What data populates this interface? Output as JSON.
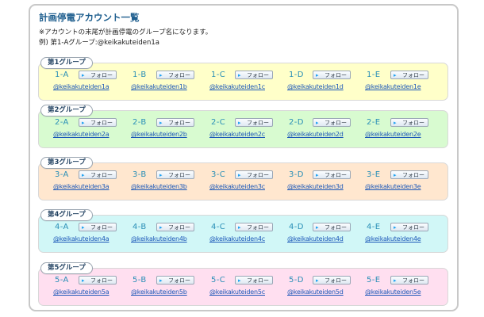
{
  "title": "計画停電アカウント一覧",
  "note1": "※アカウントの末尾が計画停電のグループ名になります。",
  "note2": "例) 第1-Aグループ:@keikakuteiden1a",
  "follow_label": "フォロー",
  "groups": [
    {
      "label": "第1グループ",
      "color": "#ffffc9",
      "accounts": [
        {
          "code": "1-A",
          "handle": "@keikakuteiden1a"
        },
        {
          "code": "1-B",
          "handle": "@keikakuteiden1b"
        },
        {
          "code": "1-C",
          "handle": "@keikakuteiden1c"
        },
        {
          "code": "1-D",
          "handle": "@keikakuteiden1d"
        },
        {
          "code": "1-E",
          "handle": "@keikakuteiden1e"
        }
      ]
    },
    {
      "label": "第2グループ",
      "color": "#d8fbd0",
      "accounts": [
        {
          "code": "2-A",
          "handle": "@keikakuteiden2a"
        },
        {
          "code": "2-B",
          "handle": "@keikakuteiden2b"
        },
        {
          "code": "2-C",
          "handle": "@keikakuteiden2c"
        },
        {
          "code": "2-D",
          "handle": "@keikakuteiden2d"
        },
        {
          "code": "2-E",
          "handle": "@keikakuteiden2e"
        }
      ]
    },
    {
      "label": "第3グループ",
      "color": "#ffe7cf",
      "accounts": [
        {
          "code": "3-A",
          "handle": "@keikakuteiden3a"
        },
        {
          "code": "3-B",
          "handle": "@keikakuteiden3b"
        },
        {
          "code": "3-C",
          "handle": "@keikakuteiden3c"
        },
        {
          "code": "3-D",
          "handle": "@keikakuteiden3d"
        },
        {
          "code": "3-E",
          "handle": "@keikakuteiden3e"
        }
      ]
    },
    {
      "label": "第4グループ",
      "color": "#d1f7f7",
      "accounts": [
        {
          "code": "4-A",
          "handle": "@keikakuteiden4a"
        },
        {
          "code": "4-B",
          "handle": "@keikakuteiden4b"
        },
        {
          "code": "4-C",
          "handle": "@keikakuteiden4c"
        },
        {
          "code": "4-D",
          "handle": "@keikakuteiden4d"
        },
        {
          "code": "4-E",
          "handle": "@keikakuteiden4e"
        }
      ]
    },
    {
      "label": "第5グループ",
      "color": "#ffdff0",
      "accounts": [
        {
          "code": "5-A",
          "handle": "@keikakuteiden5a"
        },
        {
          "code": "5-B",
          "handle": "@keikakuteiden5b"
        },
        {
          "code": "5-C",
          "handle": "@keikakuteiden5c"
        },
        {
          "code": "5-D",
          "handle": "@keikakuteiden5d"
        },
        {
          "code": "5-E",
          "handle": "@keikakuteiden5e"
        }
      ]
    }
  ]
}
